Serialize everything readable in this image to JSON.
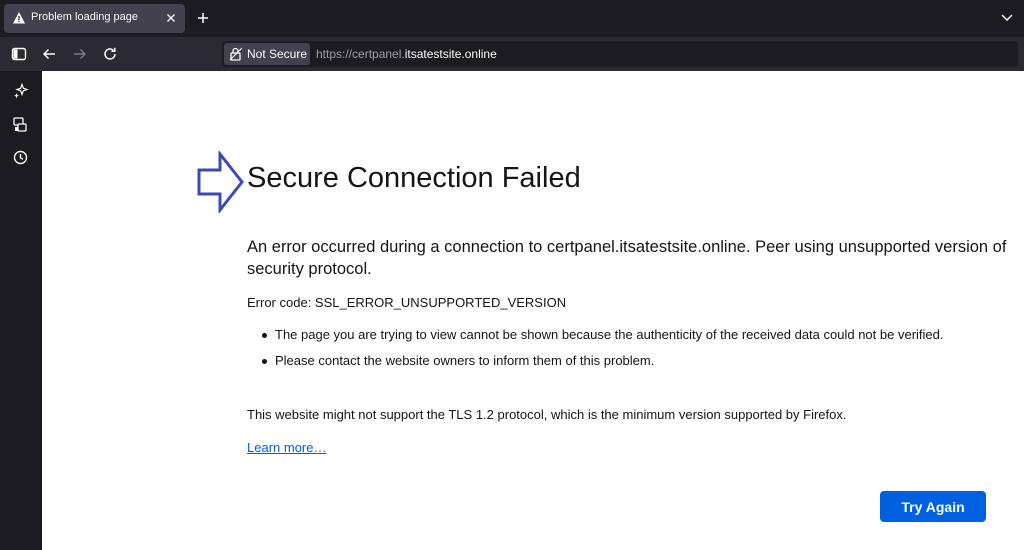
{
  "browser": {
    "tab": {
      "title": "Problem loading page",
      "icon": "warning-icon"
    },
    "toolbar": {
      "icons": [
        "sidebar-toggle-icon",
        "back-icon",
        "forward-icon",
        "reload-icon"
      ],
      "security_label": "Not Secure",
      "url_prefix": "https://certpanel.",
      "url_domain": "itsatestsite.online"
    },
    "sidebar": {
      "icons": [
        "ai-chatbot-icon",
        "synced-tabs-icon",
        "history-icon"
      ]
    }
  },
  "error_page": {
    "title": "Secure Connection Failed",
    "description": "An error occurred during a connection to certpanel.itsatestsite.online. Peer using unsupported version of security protocol.",
    "error_code": "Error code: SSL_ERROR_UNSUPPORTED_VERSION",
    "bullets": [
      "The page you are trying to view cannot be shown because the authenticity of the received data could not be verified.",
      "Please contact the website owners to inform them of this problem."
    ],
    "note": "This website might not support the TLS 1.2 protocol, which is the minimum version supported by Firefox.",
    "learn_more": "Learn more…",
    "try_again": "Try Again"
  },
  "colors": {
    "accent": "#0061e0",
    "annotation_arrow": "#3b4bb0",
    "chrome_dark": "#1c1b22",
    "toolbar": "#2b2a33"
  }
}
